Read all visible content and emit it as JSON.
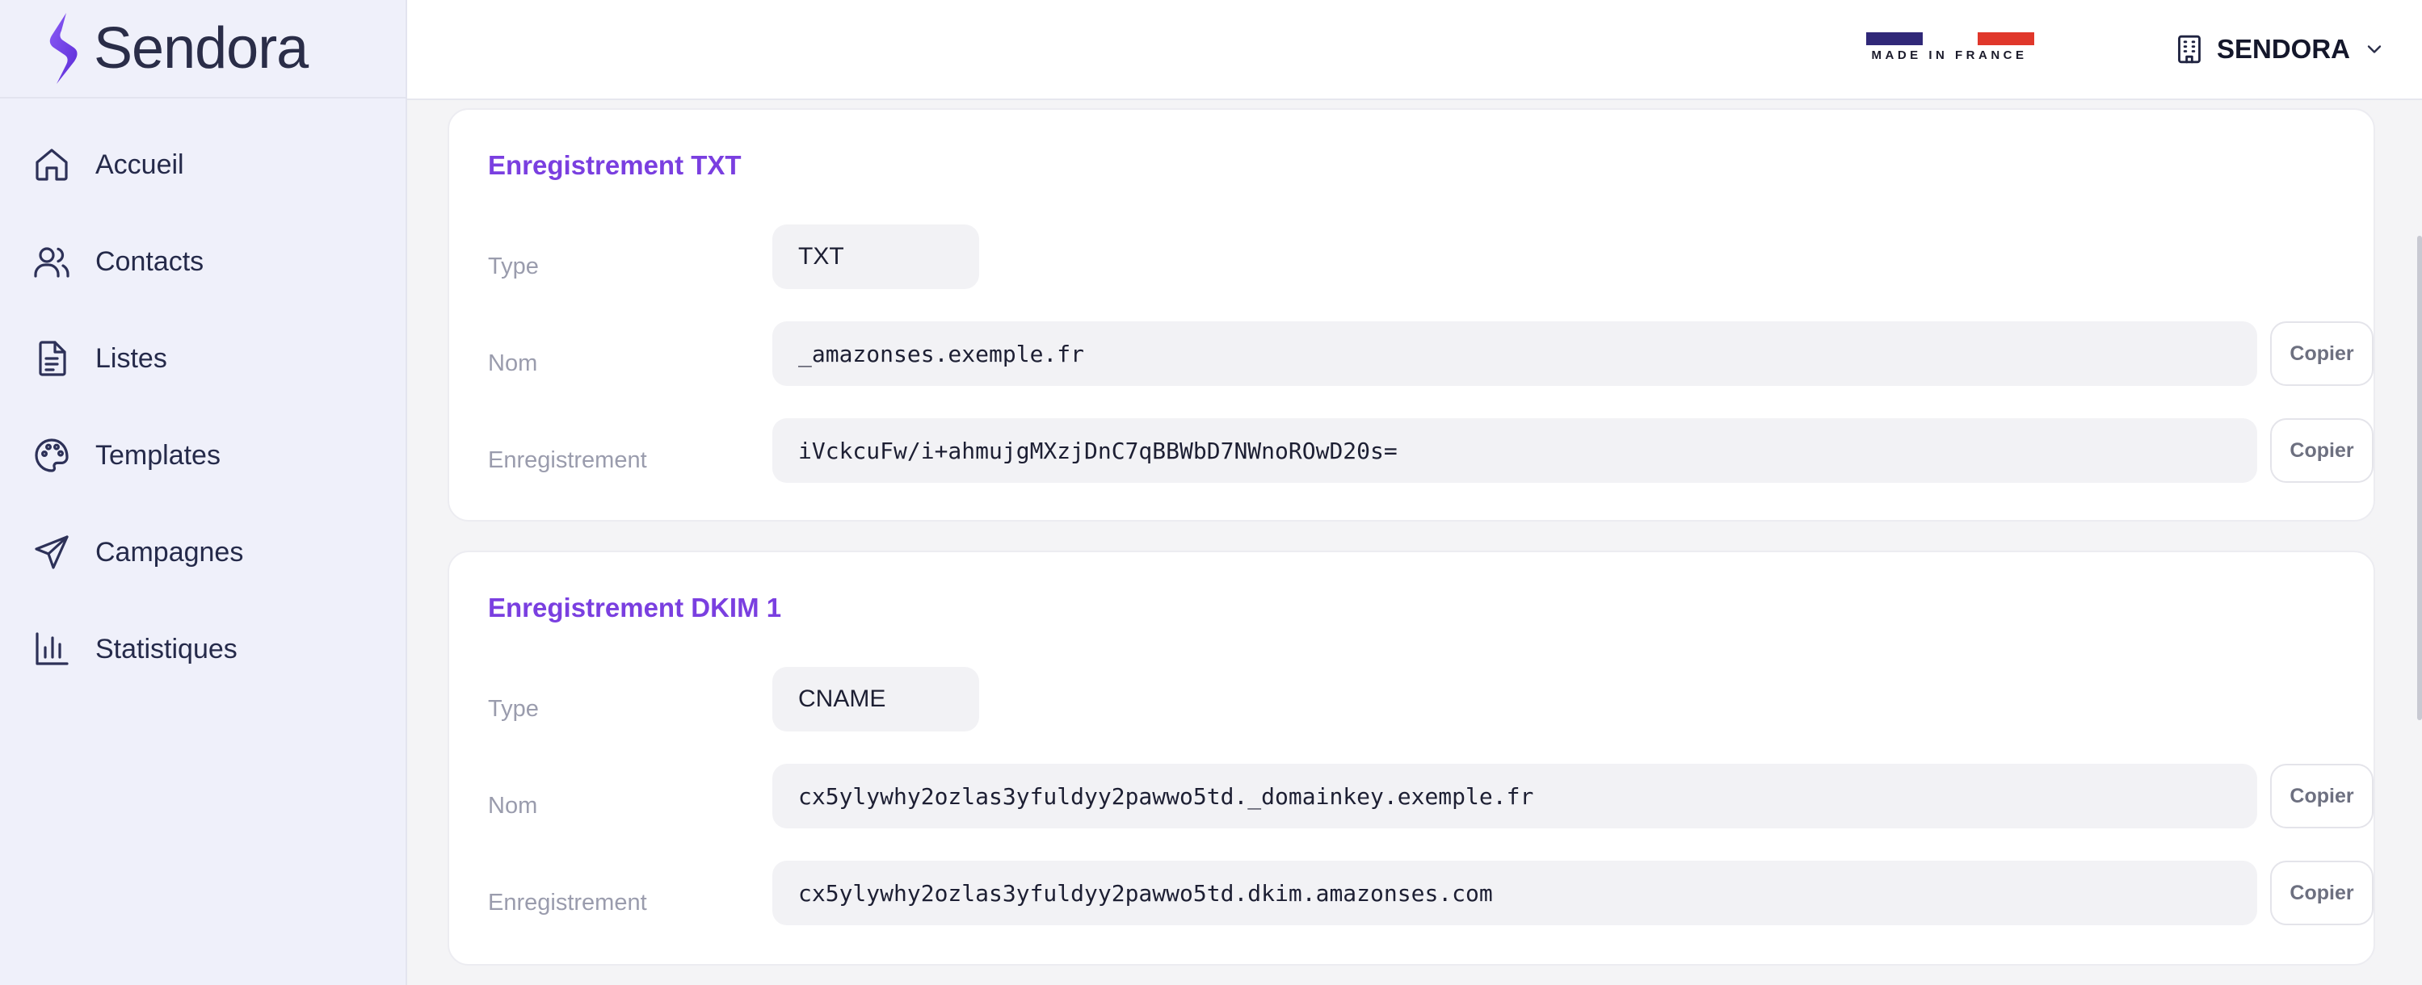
{
  "app": {
    "brand_name": "Sendora"
  },
  "sidebar": {
    "items": [
      {
        "label": "Accueil",
        "icon": "home-icon"
      },
      {
        "label": "Contacts",
        "icon": "users-icon"
      },
      {
        "label": "Listes",
        "icon": "document-list-icon"
      },
      {
        "label": "Templates",
        "icon": "palette-icon"
      },
      {
        "label": "Campagnes",
        "icon": "paper-plane-icon"
      },
      {
        "label": "Statistiques",
        "icon": "bar-chart-icon"
      }
    ]
  },
  "header": {
    "badge_text": "MADE IN FRANCE",
    "organization": "SENDORA"
  },
  "labels": {
    "type": "Type",
    "name": "Nom",
    "record": "Enregistrement",
    "copy": "Copier"
  },
  "records": [
    {
      "title": "Enregistrement TXT",
      "type": "TXT",
      "name": "_amazonses.exemple.fr",
      "value": "iVckcuFw/i+ahmujgMXzjDnC7qBBWbD7NWnoROwD20s="
    },
    {
      "title": "Enregistrement DKIM 1",
      "type": "CNAME",
      "name": "cx5ylywhy2ozlas3yfuldyy2pawwo5td._domainkey.exemple.fr",
      "value": "cx5ylywhy2ozlas3yfuldyy2pawwo5td.dkim.amazonses.com"
    }
  ],
  "colors": {
    "accent": "#7a3fe0",
    "sidebar_bg": "#eff0fa",
    "flag_blue": "#302878",
    "flag_red": "#e0372b"
  }
}
